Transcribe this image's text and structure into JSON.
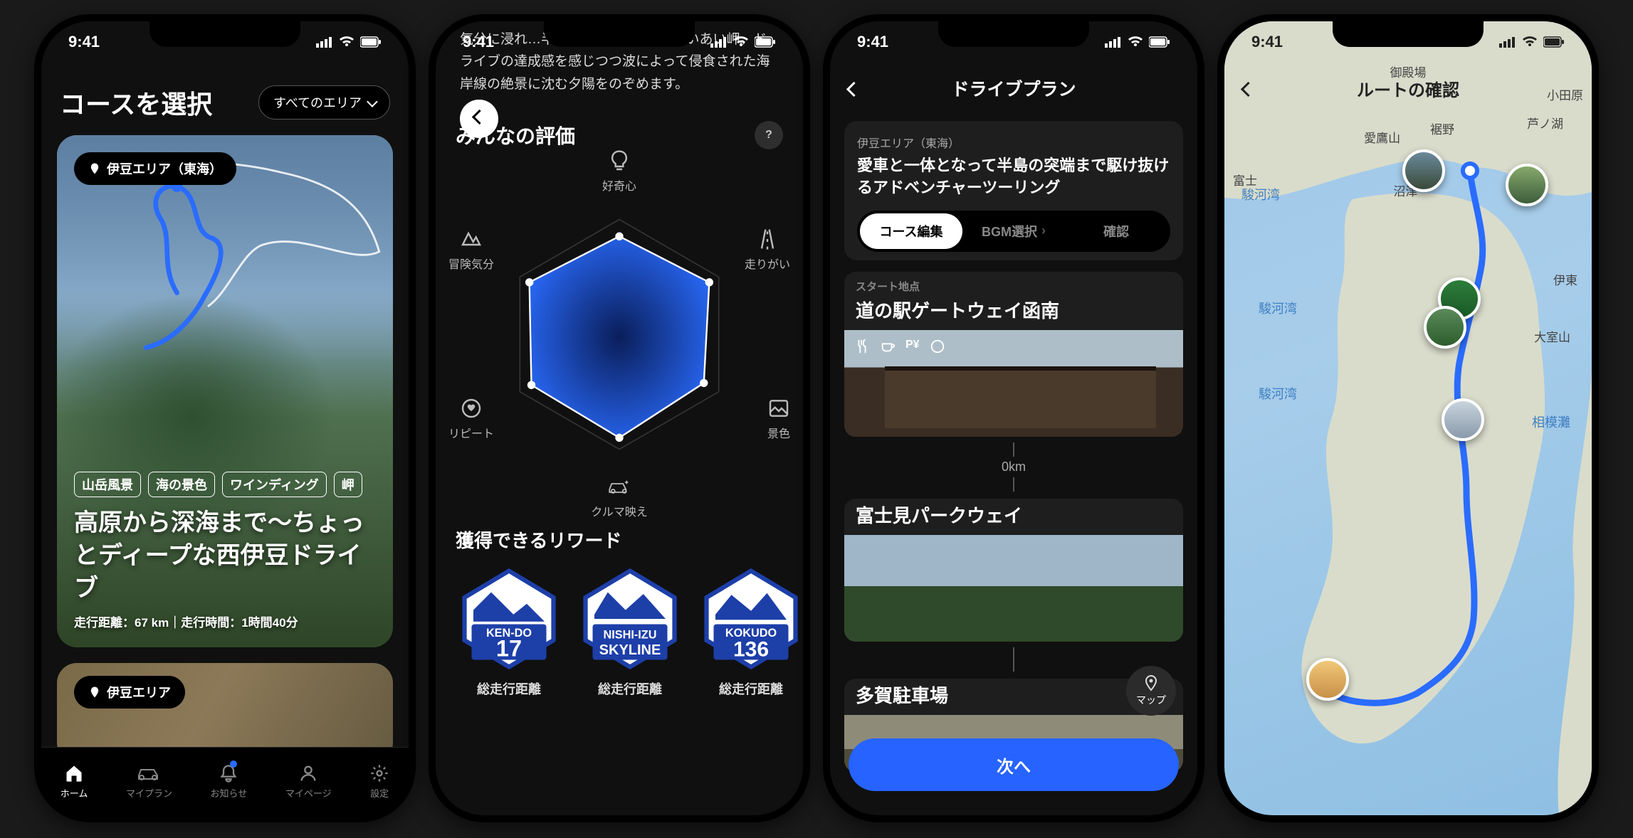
{
  "status": {
    "time": "9:41"
  },
  "screen1": {
    "title": "コースを選択",
    "filter": "すべてのエリア",
    "card": {
      "area": "伊豆エリア（東海）",
      "tags": [
        "山岳風景",
        "海の景色",
        "ワインディング",
        "岬"
      ],
      "title": "高原から深海まで～ちょっとディープな西伊豆ドライブ",
      "stats": "走行距離：67 km｜走行時間：1時間40分"
    },
    "card2_area": "伊豆エリア",
    "tabs": {
      "home": "ホーム",
      "myplan": "マイプラン",
      "news": "お知らせ",
      "mypage": "マイページ",
      "settings": "設定"
    }
  },
  "screen2": {
    "desc": "気分に浸れ…半島の…端\"奥石廊\"のあいあい岬。ドライブの達成感を感じつつ波によって侵食された海岸線の絶景に沈む夕陽をのぞめます。",
    "section": "みんなの評価",
    "radar_labels": {
      "top": "好奇心",
      "tr": "走りがい",
      "br": "景色",
      "bottom": "クルマ映え",
      "bl": "リピート",
      "tl": "冒険気分"
    },
    "rewards_head": "獲得できるリワード",
    "badges": [
      {
        "line1": "KEN-DO",
        "line2": "17",
        "caption": "総走行距離"
      },
      {
        "line1": "NISHI-IZU",
        "line2": "SKYLINE",
        "caption": "総走行距離"
      },
      {
        "line1": "KOKUDO",
        "line2": "136",
        "caption": "総走行距離"
      }
    ]
  },
  "screen3": {
    "header": "ドライブプラン",
    "area": "伊豆エリア（東海）",
    "plan_title": "愛車と一体となって半島の突端まで駆け抜けるアドベンチャーツーリング",
    "seg": {
      "a": "コース編集",
      "b": "BGM選択",
      "c": "確認"
    },
    "items": {
      "start_label": "スタート地点",
      "start_name": "道の駅ゲートウェイ函南",
      "dist": "0km",
      "wp1": "富士見パークウェイ",
      "wp2": "多賀駐車場"
    },
    "map_btn": "マップ",
    "next": "次へ"
  },
  "screen4": {
    "header": "ルートの確認",
    "labels": {
      "gotemba": "御殿場",
      "odawara": "小田原",
      "susono": "裾野",
      "ashinoko": "芦ノ湖",
      "airaka": "愛鷹山",
      "fuji": "富士",
      "numazu": "沼津",
      "ito": "伊東",
      "daimuro": "大室山",
      "suruga1": "駿河湾",
      "suruga2": "駿河湾",
      "suruga3": "駿河湾",
      "sagami": "相模灘"
    }
  },
  "chart_data": {
    "type": "radar",
    "title": "みんなの評価",
    "categories": [
      "好奇心",
      "走りがい",
      "景色",
      "クルマ映え",
      "リピート",
      "冒険気分"
    ],
    "values": [
      0.85,
      0.9,
      0.85,
      0.9,
      0.88,
      0.9
    ],
    "range": [
      0,
      1
    ]
  }
}
